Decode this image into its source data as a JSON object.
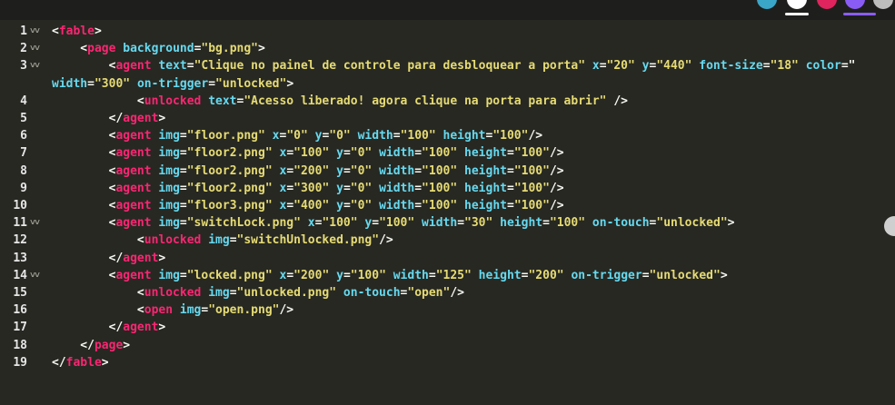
{
  "lines": [
    {
      "n": "1",
      "fold": "˅˅"
    },
    {
      "n": "2",
      "fold": "˅˅"
    },
    {
      "n": "3",
      "fold": "˅˅"
    },
    {
      "n": "",
      "fold": ""
    },
    {
      "n": "4",
      "fold": ""
    },
    {
      "n": "5",
      "fold": ""
    },
    {
      "n": "6",
      "fold": ""
    },
    {
      "n": "7",
      "fold": ""
    },
    {
      "n": "8",
      "fold": ""
    },
    {
      "n": "9",
      "fold": ""
    },
    {
      "n": "10",
      "fold": ""
    },
    {
      "n": "11",
      "fold": "˅˅"
    },
    {
      "n": "12",
      "fold": ""
    },
    {
      "n": "13",
      "fold": ""
    },
    {
      "n": "14",
      "fold": "˅˅"
    },
    {
      "n": "15",
      "fold": ""
    },
    {
      "n": "16",
      "fold": ""
    },
    {
      "n": "17",
      "fold": ""
    },
    {
      "n": "18",
      "fold": ""
    },
    {
      "n": "19",
      "fold": ""
    }
  ],
  "code": [
    [
      [
        "p",
        "<"
      ],
      [
        "t",
        "fable"
      ],
      [
        "p",
        ">"
      ]
    ],
    [
      [
        "p",
        "    <"
      ],
      [
        "t",
        "page"
      ],
      [
        "p",
        " "
      ],
      [
        "a",
        "background"
      ],
      [
        "p",
        "="
      ],
      [
        "s",
        "\"bg.png\""
      ],
      [
        "p",
        ">"
      ]
    ],
    [
      [
        "p",
        "        <"
      ],
      [
        "t",
        "agent"
      ],
      [
        "p",
        " "
      ],
      [
        "a",
        "text"
      ],
      [
        "p",
        "="
      ],
      [
        "s",
        "\"Clique no painel de controle para desbloquear a porta\""
      ],
      [
        "p",
        " "
      ],
      [
        "a",
        "x"
      ],
      [
        "p",
        "="
      ],
      [
        "s",
        "\"20\""
      ],
      [
        "p",
        " "
      ],
      [
        "a",
        "y"
      ],
      [
        "p",
        "="
      ],
      [
        "s",
        "\"440\""
      ],
      [
        "p",
        " "
      ],
      [
        "a",
        "font-size"
      ],
      [
        "p",
        "="
      ],
      [
        "s",
        "\"18\""
      ],
      [
        "p",
        " "
      ],
      [
        "a",
        "color"
      ],
      [
        "p",
        "=\""
      ]
    ],
    [
      [
        "a",
        "width"
      ],
      [
        "p",
        "="
      ],
      [
        "s",
        "\"300\""
      ],
      [
        "p",
        " "
      ],
      [
        "a",
        "on-trigger"
      ],
      [
        "p",
        "="
      ],
      [
        "s",
        "\"unlocked\""
      ],
      [
        "p",
        ">"
      ]
    ],
    [
      [
        "p",
        "            <"
      ],
      [
        "t",
        "unlocked"
      ],
      [
        "p",
        " "
      ],
      [
        "a",
        "text"
      ],
      [
        "p",
        "="
      ],
      [
        "s",
        "\"Acesso liberado! agora clique na porta para abrir\""
      ],
      [
        "p",
        " />"
      ]
    ],
    [
      [
        "p",
        "        </"
      ],
      [
        "t",
        "agent"
      ],
      [
        "p",
        ">"
      ]
    ],
    [
      [
        "p",
        "        <"
      ],
      [
        "t",
        "agent"
      ],
      [
        "p",
        " "
      ],
      [
        "a",
        "img"
      ],
      [
        "p",
        "="
      ],
      [
        "s",
        "\"floor.png\""
      ],
      [
        "p",
        " "
      ],
      [
        "a",
        "x"
      ],
      [
        "p",
        "="
      ],
      [
        "s",
        "\"0\""
      ],
      [
        "p",
        " "
      ],
      [
        "a",
        "y"
      ],
      [
        "p",
        "="
      ],
      [
        "s",
        "\"0\""
      ],
      [
        "p",
        " "
      ],
      [
        "a",
        "width"
      ],
      [
        "p",
        "="
      ],
      [
        "s",
        "\"100\""
      ],
      [
        "p",
        " "
      ],
      [
        "a",
        "height"
      ],
      [
        "p",
        "="
      ],
      [
        "s",
        "\"100\""
      ],
      [
        "p",
        "/>"
      ]
    ],
    [
      [
        "p",
        "        <"
      ],
      [
        "t",
        "agent"
      ],
      [
        "p",
        " "
      ],
      [
        "a",
        "img"
      ],
      [
        "p",
        "="
      ],
      [
        "s",
        "\"floor2.png\""
      ],
      [
        "p",
        " "
      ],
      [
        "a",
        "x"
      ],
      [
        "p",
        "="
      ],
      [
        "s",
        "\"100\""
      ],
      [
        "p",
        " "
      ],
      [
        "a",
        "y"
      ],
      [
        "p",
        "="
      ],
      [
        "s",
        "\"0\""
      ],
      [
        "p",
        " "
      ],
      [
        "a",
        "width"
      ],
      [
        "p",
        "="
      ],
      [
        "s",
        "\"100\""
      ],
      [
        "p",
        " "
      ],
      [
        "a",
        "height"
      ],
      [
        "p",
        "="
      ],
      [
        "s",
        "\"100\""
      ],
      [
        "p",
        "/>"
      ]
    ],
    [
      [
        "p",
        "        <"
      ],
      [
        "t",
        "agent"
      ],
      [
        "p",
        " "
      ],
      [
        "a",
        "img"
      ],
      [
        "p",
        "="
      ],
      [
        "s",
        "\"floor2.png\""
      ],
      [
        "p",
        " "
      ],
      [
        "a",
        "x"
      ],
      [
        "p",
        "="
      ],
      [
        "s",
        "\"200\""
      ],
      [
        "p",
        " "
      ],
      [
        "a",
        "y"
      ],
      [
        "p",
        "="
      ],
      [
        "s",
        "\"0\""
      ],
      [
        "p",
        " "
      ],
      [
        "a",
        "width"
      ],
      [
        "p",
        "="
      ],
      [
        "s",
        "\"100\""
      ],
      [
        "p",
        " "
      ],
      [
        "a",
        "height"
      ],
      [
        "p",
        "="
      ],
      [
        "s",
        "\"100\""
      ],
      [
        "p",
        "/>"
      ]
    ],
    [
      [
        "p",
        "        <"
      ],
      [
        "t",
        "agent"
      ],
      [
        "p",
        " "
      ],
      [
        "a",
        "img"
      ],
      [
        "p",
        "="
      ],
      [
        "s",
        "\"floor2.png\""
      ],
      [
        "p",
        " "
      ],
      [
        "a",
        "x"
      ],
      [
        "p",
        "="
      ],
      [
        "s",
        "\"300\""
      ],
      [
        "p",
        " "
      ],
      [
        "a",
        "y"
      ],
      [
        "p",
        "="
      ],
      [
        "s",
        "\"0\""
      ],
      [
        "p",
        " "
      ],
      [
        "a",
        "width"
      ],
      [
        "p",
        "="
      ],
      [
        "s",
        "\"100\""
      ],
      [
        "p",
        " "
      ],
      [
        "a",
        "height"
      ],
      [
        "p",
        "="
      ],
      [
        "s",
        "\"100\""
      ],
      [
        "p",
        "/>"
      ]
    ],
    [
      [
        "p",
        "        <"
      ],
      [
        "t",
        "agent"
      ],
      [
        "p",
        " "
      ],
      [
        "a",
        "img"
      ],
      [
        "p",
        "="
      ],
      [
        "s",
        "\"floor3.png\""
      ],
      [
        "p",
        " "
      ],
      [
        "a",
        "x"
      ],
      [
        "p",
        "="
      ],
      [
        "s",
        "\"400\""
      ],
      [
        "p",
        " "
      ],
      [
        "a",
        "y"
      ],
      [
        "p",
        "="
      ],
      [
        "s",
        "\"0\""
      ],
      [
        "p",
        " "
      ],
      [
        "a",
        "width"
      ],
      [
        "p",
        "="
      ],
      [
        "s",
        "\"100\""
      ],
      [
        "p",
        " "
      ],
      [
        "a",
        "height"
      ],
      [
        "p",
        "="
      ],
      [
        "s",
        "\"100\""
      ],
      [
        "p",
        "/>"
      ]
    ],
    [
      [
        "p",
        "        <"
      ],
      [
        "t",
        "agent"
      ],
      [
        "p",
        " "
      ],
      [
        "a",
        "img"
      ],
      [
        "p",
        "="
      ],
      [
        "s",
        "\"switchLock.png\""
      ],
      [
        "p",
        " "
      ],
      [
        "a",
        "x"
      ],
      [
        "p",
        "="
      ],
      [
        "s",
        "\"100\""
      ],
      [
        "p",
        " "
      ],
      [
        "a",
        "y"
      ],
      [
        "p",
        "="
      ],
      [
        "s",
        "\"100\""
      ],
      [
        "p",
        " "
      ],
      [
        "a",
        "width"
      ],
      [
        "p",
        "="
      ],
      [
        "s",
        "\"30\""
      ],
      [
        "p",
        " "
      ],
      [
        "a",
        "height"
      ],
      [
        "p",
        "="
      ],
      [
        "s",
        "\"100\""
      ],
      [
        "p",
        " "
      ],
      [
        "a",
        "on-touch"
      ],
      [
        "p",
        "="
      ],
      [
        "s",
        "\"unlocked\""
      ],
      [
        "p",
        ">"
      ]
    ],
    [
      [
        "p",
        "            <"
      ],
      [
        "t",
        "unlocked"
      ],
      [
        "p",
        " "
      ],
      [
        "a",
        "img"
      ],
      [
        "p",
        "="
      ],
      [
        "s",
        "\"switchUnlocked.png\""
      ],
      [
        "p",
        "/>"
      ]
    ],
    [
      [
        "p",
        "        </"
      ],
      [
        "t",
        "agent"
      ],
      [
        "p",
        ">"
      ]
    ],
    [
      [
        "p",
        "        <"
      ],
      [
        "t",
        "agent"
      ],
      [
        "p",
        " "
      ],
      [
        "a",
        "img"
      ],
      [
        "p",
        "="
      ],
      [
        "s",
        "\"locked.png\""
      ],
      [
        "p",
        " "
      ],
      [
        "a",
        "x"
      ],
      [
        "p",
        "="
      ],
      [
        "s",
        "\"200\""
      ],
      [
        "p",
        " "
      ],
      [
        "a",
        "y"
      ],
      [
        "p",
        "="
      ],
      [
        "s",
        "\"100\""
      ],
      [
        "p",
        " "
      ],
      [
        "a",
        "width"
      ],
      [
        "p",
        "="
      ],
      [
        "s",
        "\"125\""
      ],
      [
        "p",
        " "
      ],
      [
        "a",
        "height"
      ],
      [
        "p",
        "="
      ],
      [
        "s",
        "\"200\""
      ],
      [
        "p",
        " "
      ],
      [
        "a",
        "on-trigger"
      ],
      [
        "p",
        "="
      ],
      [
        "s",
        "\"unlocked\""
      ],
      [
        "p",
        ">"
      ]
    ],
    [
      [
        "p",
        "            <"
      ],
      [
        "t",
        "unlocked"
      ],
      [
        "p",
        " "
      ],
      [
        "a",
        "img"
      ],
      [
        "p",
        "="
      ],
      [
        "s",
        "\"unlocked.png\""
      ],
      [
        "p",
        " "
      ],
      [
        "a",
        "on-touch"
      ],
      [
        "p",
        "="
      ],
      [
        "s",
        "\"open\""
      ],
      [
        "p",
        "/>"
      ]
    ],
    [
      [
        "p",
        "            <"
      ],
      [
        "t",
        "open"
      ],
      [
        "p",
        " "
      ],
      [
        "a",
        "img"
      ],
      [
        "p",
        "="
      ],
      [
        "s",
        "\"open.png\""
      ],
      [
        "p",
        "/>"
      ]
    ],
    [
      [
        "p",
        "        </"
      ],
      [
        "t",
        "agent"
      ],
      [
        "p",
        ">"
      ]
    ],
    [
      [
        "p",
        "    </"
      ],
      [
        "t",
        "page"
      ],
      [
        "p",
        ">"
      ]
    ],
    [
      [
        "p",
        "</"
      ],
      [
        "t",
        "fable"
      ],
      [
        "p",
        ">"
      ]
    ]
  ],
  "colors": {
    "background": "#272822",
    "tag": "#f92672",
    "attribute": "#66d9ef",
    "string": "#e6db74",
    "punctuation": "#f8f8f2"
  }
}
